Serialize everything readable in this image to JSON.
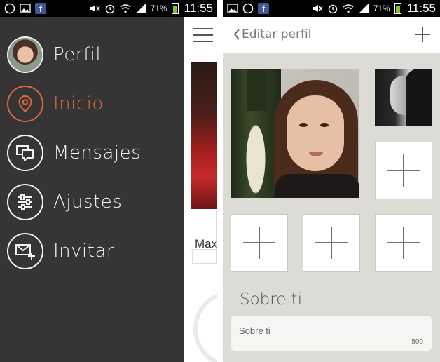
{
  "status_bar": {
    "battery_percent": "71%",
    "time": "11:55",
    "icons": [
      "whatsapp-icon",
      "gallery-icon",
      "facebook-icon",
      "mute-icon",
      "alarm-icon",
      "wifi-icon",
      "signal-icon",
      "battery-icon"
    ],
    "facebook_glyph": "f"
  },
  "menu": {
    "items": [
      {
        "id": "perfil",
        "label": "Perfil",
        "icon": "avatar"
      },
      {
        "id": "inicio",
        "label": "Inicio",
        "icon": "location-pin-icon",
        "active": true
      },
      {
        "id": "mensajes",
        "label": "Mensajes",
        "icon": "chat-bubbles-icon"
      },
      {
        "id": "ajustes",
        "label": "Ajustes",
        "icon": "sliders-icon"
      },
      {
        "id": "invitar",
        "label": "Invitar",
        "icon": "invite-mail-icon"
      }
    ],
    "active_color": "#e0643c"
  },
  "main_peek": {
    "card_name_fragment": "Max"
  },
  "edit_profile": {
    "title": "Editar perfil",
    "section_title": "Sobre ti",
    "about_placeholder": "Sobre ti",
    "about_char_limit": "500"
  }
}
